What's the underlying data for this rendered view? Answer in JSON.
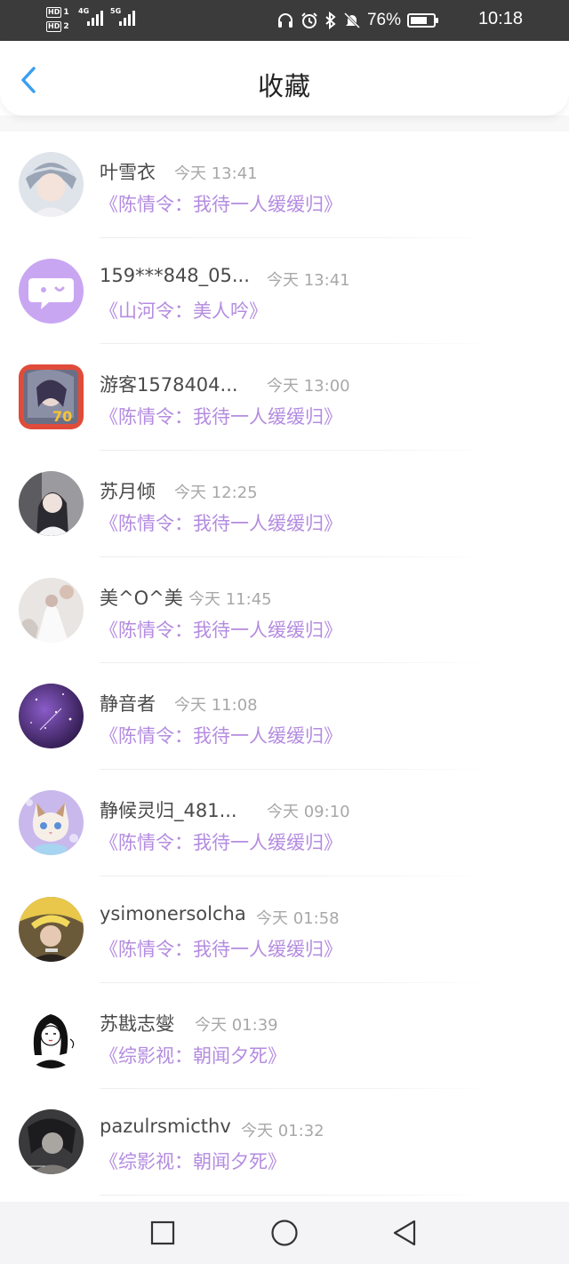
{
  "status_bar": {
    "hd1": "HD",
    "hd1_num": "1",
    "hd2": "HD",
    "hd2_num": "2",
    "net1": "4G",
    "net2": "5G",
    "battery_pct": "76%",
    "time": "10:18",
    "battery_level": 0.76
  },
  "header": {
    "title": "收藏",
    "accent_color": "#3a9ff0"
  },
  "colors": {
    "book_title": "#b48ce0",
    "name": "#4a4a4a",
    "time": "#a8a8a8"
  },
  "items": [
    {
      "name": "叶雪衣",
      "time": "今天 13:41",
      "book": "《陈情令：我待一人缓缓归》",
      "avatar_icon": "avatar-girl-silver-headdress"
    },
    {
      "name": "159***848_05...",
      "time": "今天 13:41",
      "book": "《山河令：美人吟》",
      "avatar_icon": "avatar-default-chat-bubble"
    },
    {
      "name": "游客1578404...",
      "time": "今天 13:00",
      "book": "《陈情令：我待一人缓缓归》",
      "avatar_icon": "avatar-anime-girl"
    },
    {
      "name": "苏月倾",
      "time": "今天 12:25",
      "book": "《陈情令：我待一人缓缓归》",
      "avatar_icon": "avatar-girl-photo"
    },
    {
      "name": "美^O^美",
      "time": "今天 11:45",
      "book": "《陈情令：我待一人缓缓归》",
      "avatar_icon": "avatar-white-dress"
    },
    {
      "name": "静音者",
      "time": "今天 11:08",
      "book": "《陈情令：我待一人缓缓归》",
      "avatar_icon": "avatar-purple-galaxy"
    },
    {
      "name": "静候灵归_481...",
      "time": "今天 09:10",
      "book": "《陈情令：我待一人缓缓归》",
      "avatar_icon": "avatar-cat"
    },
    {
      "name": "ysimonersolcha",
      "time": "今天 01:58",
      "book": "《陈情令：我待一人缓缓归》",
      "avatar_icon": "avatar-girl-yellow-hat"
    },
    {
      "name": "苏戡志燮",
      "time": "今天 01:39",
      "book": "《综影视：朝闻夕死》",
      "avatar_icon": "avatar-sketch-girl"
    },
    {
      "name": "pazulrsmicthv",
      "time": "今天 01:32",
      "book": "《综影视：朝闻夕死》",
      "avatar_icon": "avatar-dark-photo"
    }
  ]
}
